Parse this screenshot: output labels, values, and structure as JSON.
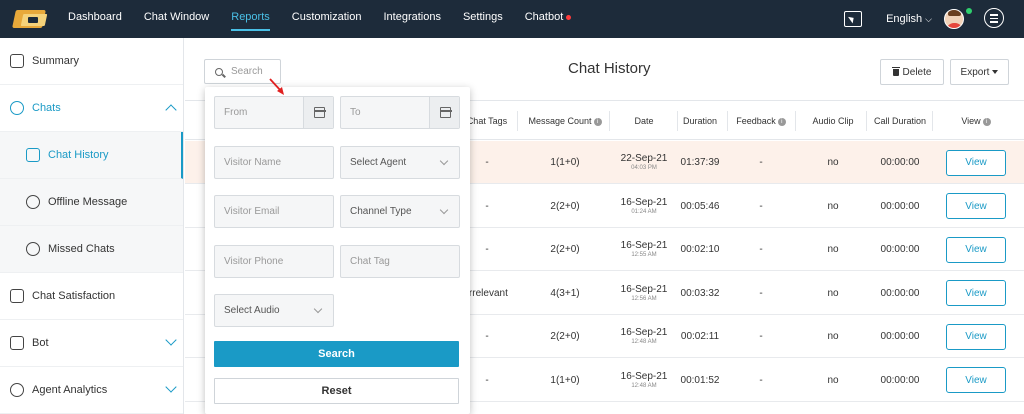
{
  "nav": {
    "items": [
      "Dashboard",
      "Chat Window",
      "Reports",
      "Customization",
      "Integrations",
      "Settings",
      "Chatbot"
    ],
    "active": "Reports",
    "language": "English"
  },
  "sidebar": {
    "items": [
      {
        "label": "Summary",
        "icon": "document-icon"
      },
      {
        "label": "Chats",
        "icon": "chat-bubble-icon",
        "expanded": true
      },
      {
        "label": "Chat History",
        "icon": "chat-history-icon",
        "sub": true,
        "active": true
      },
      {
        "label": "Offline Message",
        "icon": "offline-icon",
        "sub": true
      },
      {
        "label": "Missed Chats",
        "icon": "missed-chat-icon",
        "sub": true
      },
      {
        "label": "Chat Satisfaction",
        "icon": "thumbs-up-icon"
      },
      {
        "label": "Bot",
        "icon": "bot-icon",
        "collapsed": true
      },
      {
        "label": "Agent Analytics",
        "icon": "analytics-icon",
        "collapsed": true
      }
    ]
  },
  "page": {
    "title": "Chat History",
    "search_label": "Search",
    "delete_label": "Delete",
    "export_label": "Export"
  },
  "table": {
    "columns": [
      "Chat Tags",
      "Message Count",
      "Date",
      "Duration",
      "Feedback",
      "Audio Clip",
      "Call Duration",
      "View"
    ],
    "rows": [
      {
        "tag": "-",
        "count": "1(1+0)",
        "date": "22-Sep-21",
        "time": "04:03 PM",
        "duration": "01:37:39",
        "feedback": "-",
        "audio": "no",
        "call": "00:00:00",
        "view": "View"
      },
      {
        "tag": "-",
        "count": "2(2+0)",
        "date": "16-Sep-21",
        "time": "01:24 AM",
        "duration": "00:05:46",
        "feedback": "-",
        "audio": "no",
        "call": "00:00:00",
        "view": "View"
      },
      {
        "tag": "-",
        "count": "2(2+0)",
        "date": "16-Sep-21",
        "time": "12:55 AM",
        "duration": "00:02:10",
        "feedback": "-",
        "audio": "no",
        "call": "00:00:00",
        "view": "View"
      },
      {
        "tag": "Irrelevant",
        "count": "4(3+1)",
        "date": "16-Sep-21",
        "time": "12:56 AM",
        "duration": "00:03:32",
        "feedback": "-",
        "audio": "no",
        "call": "00:00:00",
        "view": "View"
      },
      {
        "tag": "-",
        "count": "2(2+0)",
        "date": "16-Sep-21",
        "time": "12:48 AM",
        "duration": "00:02:11",
        "feedback": "-",
        "audio": "no",
        "call": "00:00:00",
        "view": "View"
      },
      {
        "tag": "-",
        "count": "1(1+0)",
        "date": "16-Sep-21",
        "time": "12:48 AM",
        "duration": "00:01:52",
        "feedback": "-",
        "audio": "no",
        "call": "00:00:00",
        "view": "View"
      }
    ]
  },
  "search_panel": {
    "from_placeholder": "From",
    "to_placeholder": "To",
    "visitor_name_placeholder": "Visitor Name",
    "select_agent": "Select Agent",
    "visitor_email_placeholder": "Visitor Email",
    "channel_type": "Channel Type",
    "visitor_phone_placeholder": "Visitor Phone",
    "chat_tag_placeholder": "Chat Tag",
    "select_audio": "Select Audio",
    "search_button": "Search",
    "reset_button": "Reset"
  },
  "colors": {
    "accent": "#1a9ac6",
    "nav_bg": "#1d2b3a",
    "nav_active": "#4ac0e6",
    "row_highlight": "#fdf1ea"
  }
}
